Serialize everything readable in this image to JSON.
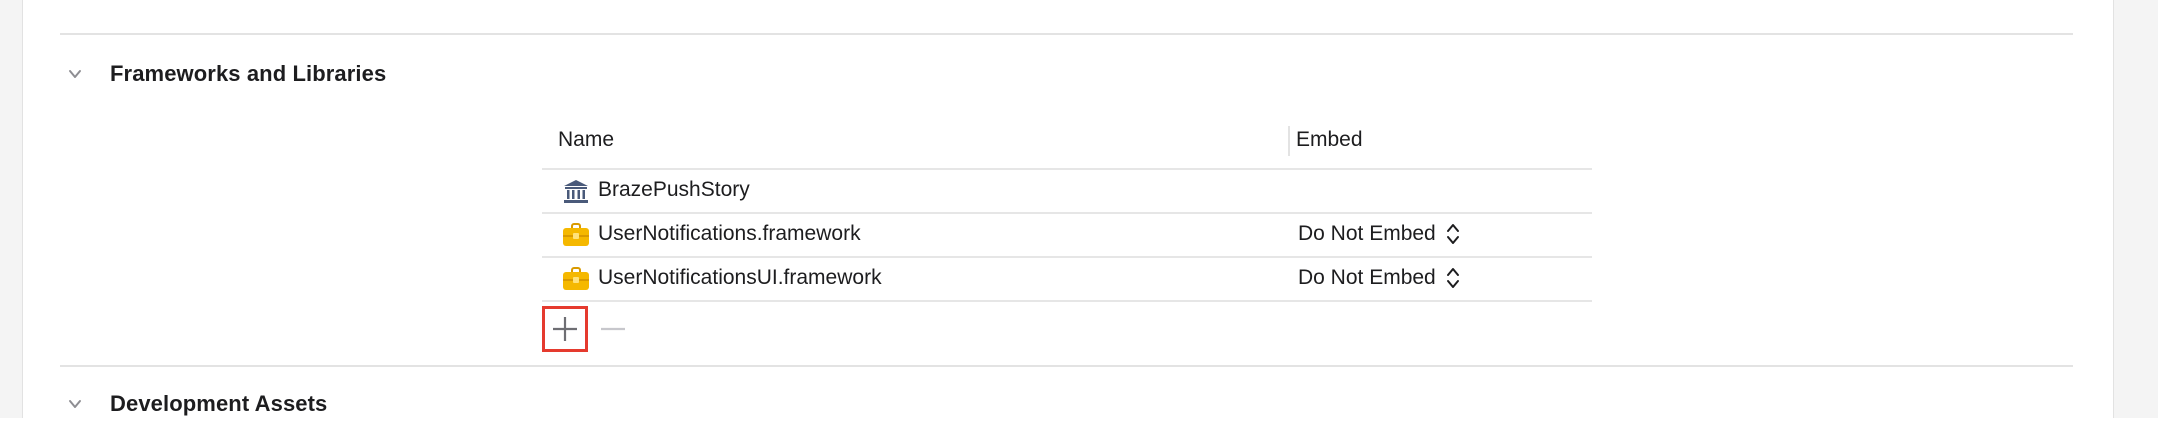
{
  "sections": {
    "frameworks": {
      "title": "Frameworks and Libraries"
    },
    "development_assets": {
      "title": "Development Assets"
    }
  },
  "table": {
    "columns": {
      "name": "Name",
      "embed": "Embed"
    },
    "rows": [
      {
        "name": "BrazePushStory",
        "embed": "",
        "icon": "bank-library-icon"
      },
      {
        "name": "UserNotifications.framework",
        "embed": "Do Not Embed",
        "icon": "toolbox-framework-icon"
      },
      {
        "name": "UserNotificationsUI.framework",
        "embed": "Do Not Embed",
        "icon": "toolbox-framework-icon"
      }
    ]
  },
  "buttons": {
    "add": {
      "icon": "plus-icon",
      "highlighted": true,
      "highlight_color": "#e53a2e"
    },
    "remove": {
      "icon": "minus-icon",
      "enabled": false
    }
  },
  "colors": {
    "framework_icon": "#f5b800",
    "library_icon": "#4a5a7a",
    "divider": "#e3e3e3"
  }
}
